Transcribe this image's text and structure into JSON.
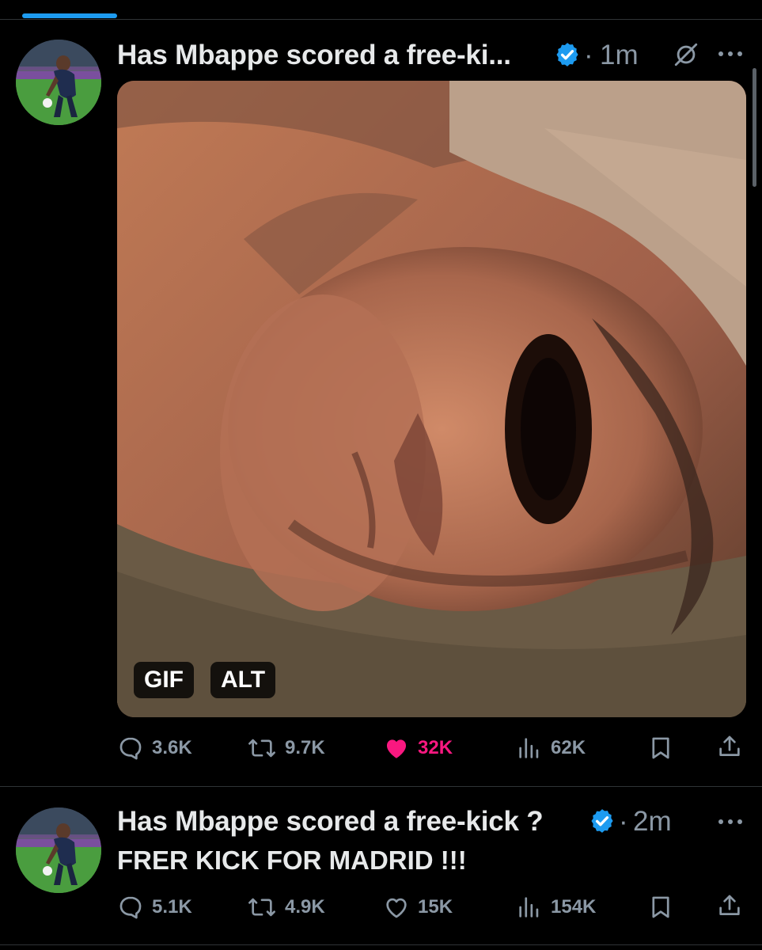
{
  "progress": {
    "value_fraction": 0.13,
    "color": "#1d9bf0"
  },
  "accent_color": "#1d9bf0",
  "like_color": "#f91880",
  "posts": [
    {
      "author": "Has Mbappe scored a free-ki...",
      "separator": "·",
      "time": "1m",
      "media": {
        "chip_gif": "GIF",
        "chip_alt": "ALT"
      },
      "actions": {
        "replies": "3.6K",
        "reposts": "9.7K",
        "likes": "32K",
        "views": "62K"
      },
      "liked": true
    },
    {
      "author": "Has Mbappe scored a free-kick ?",
      "separator": "·",
      "time": "2m",
      "text": "FRER KICK FOR MADRID !!!",
      "actions": {
        "replies": "5.1K",
        "reposts": "4.9K",
        "likes": "15K",
        "views": "154K"
      },
      "liked": false
    }
  ],
  "icons": {
    "verified": "verified-badge-icon",
    "grok": "grok-icon",
    "more": "more-options-icon",
    "reply": "reply-icon",
    "repost": "repost-icon",
    "like": "heart-icon",
    "views": "views-icon",
    "bookmark": "bookmark-icon",
    "share": "share-icon"
  }
}
